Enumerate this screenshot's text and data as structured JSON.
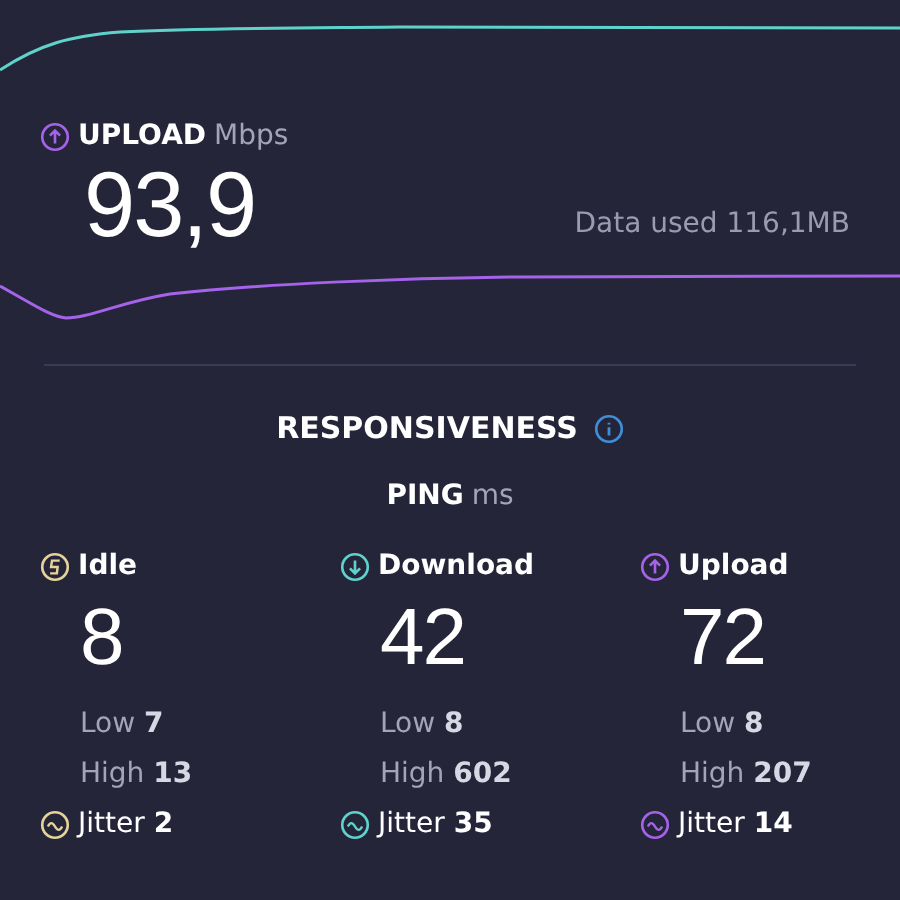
{
  "upload": {
    "label": "UPLOAD",
    "unit": "Mbps",
    "value": "93,9",
    "color": "#a463e8"
  },
  "data_used": "Data used 116,1MB",
  "responsiveness": {
    "title": "RESPONSIVENESS",
    "metric": "PING",
    "unit": "ms"
  },
  "ping": [
    {
      "kind": "idle",
      "label": "Idle",
      "value": "8",
      "low": "Low **7**",
      "high": "High **13**",
      "jitter": "Jitter **2**",
      "color": "#e6d39a"
    },
    {
      "kind": "download",
      "label": "Download",
      "value": "42",
      "low": "Low **8**",
      "high": "High **602**",
      "jitter": "Jitter **35**",
      "color": "#5fd3cb"
    },
    {
      "kind": "upload",
      "label": "Upload",
      "value": "72",
      "low": "Low **8**",
      "high": "High **207**",
      "jitter": "Jitter **14**",
      "color": "#a463e8"
    }
  ]
}
